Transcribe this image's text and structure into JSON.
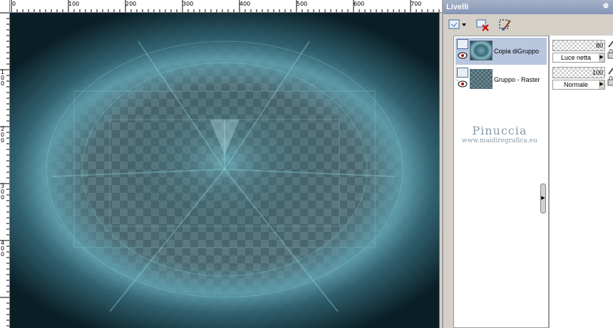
{
  "ruler": {
    "top_labels": [
      "0",
      "100",
      "200",
      "300",
      "400",
      "500",
      "600",
      "700"
    ],
    "left_labels": [
      "1\n0\n0",
      "2\n0\n0",
      "3\n0\n0",
      "4\n0\n0"
    ]
  },
  "palette": {
    "title": "Livelli",
    "layers": [
      {
        "name": "Copia diGruppo",
        "selected": true
      },
      {
        "name": "Gruppo - Raster",
        "selected": false
      }
    ],
    "props": [
      {
        "opacity": "80",
        "blend": "Luce netta"
      },
      {
        "opacity": "100",
        "blend": "Normale"
      }
    ]
  },
  "watermark": {
    "title": "Pinuccia",
    "url": "www.maidiregrafica.eu"
  },
  "colors": {
    "title_bar": "#8494b4",
    "selected_row": "#b8c6de",
    "canvas_teal": "#3a7a88"
  }
}
